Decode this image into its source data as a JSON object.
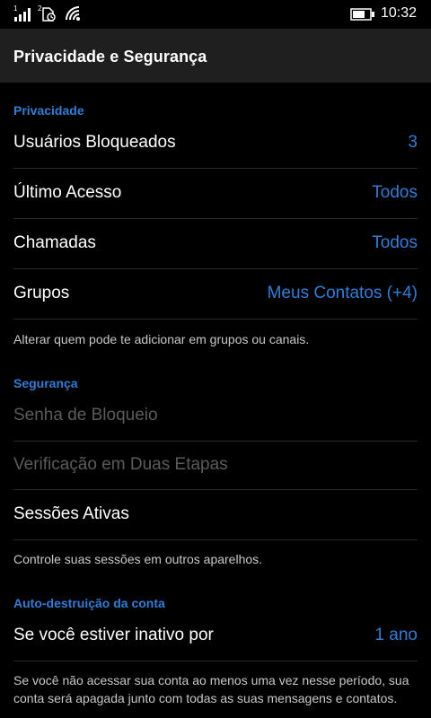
{
  "status_bar": {
    "time": "10:32",
    "signal_icon": "signal-bars-icon",
    "sim_icon": "sim-icon",
    "wifi_icon": "wifi-icon",
    "battery_icon": "battery-icon"
  },
  "header": {
    "title": "Privacidade e Segurança"
  },
  "privacy": {
    "section_title": "Privacidade",
    "blocked_users": {
      "label": "Usuários Bloqueados",
      "value": "3"
    },
    "last_seen": {
      "label": "Último Acesso",
      "value": "Todos"
    },
    "calls": {
      "label": "Chamadas",
      "value": "Todos"
    },
    "groups": {
      "label": "Grupos",
      "value": "Meus Contatos (+4)"
    },
    "groups_note": "Alterar quem pode te adicionar em grupos ou canais."
  },
  "security": {
    "section_title": "Segurança",
    "lock_password": {
      "label": "Senha de Bloqueio"
    },
    "two_step": {
      "label": "Verificação em Duas Etapas"
    },
    "active_sessions": {
      "label": "Sessões Ativas"
    },
    "sessions_note": "Controle suas sessões em outros aparelhos."
  },
  "self_destruct": {
    "section_title": "Auto-destruição da conta",
    "inactive_for": {
      "label": "Se você estiver inativo por",
      "value": "1 ano"
    },
    "note": "Se você não acessar sua conta ao menos uma vez nesse período, sua conta será apagada junto com todas as suas mensagens e contatos."
  },
  "colors": {
    "accent": "#2f7ed8",
    "background": "#000000",
    "header_background": "#1f1f1f",
    "disabled_text": "#5b5b5b"
  }
}
